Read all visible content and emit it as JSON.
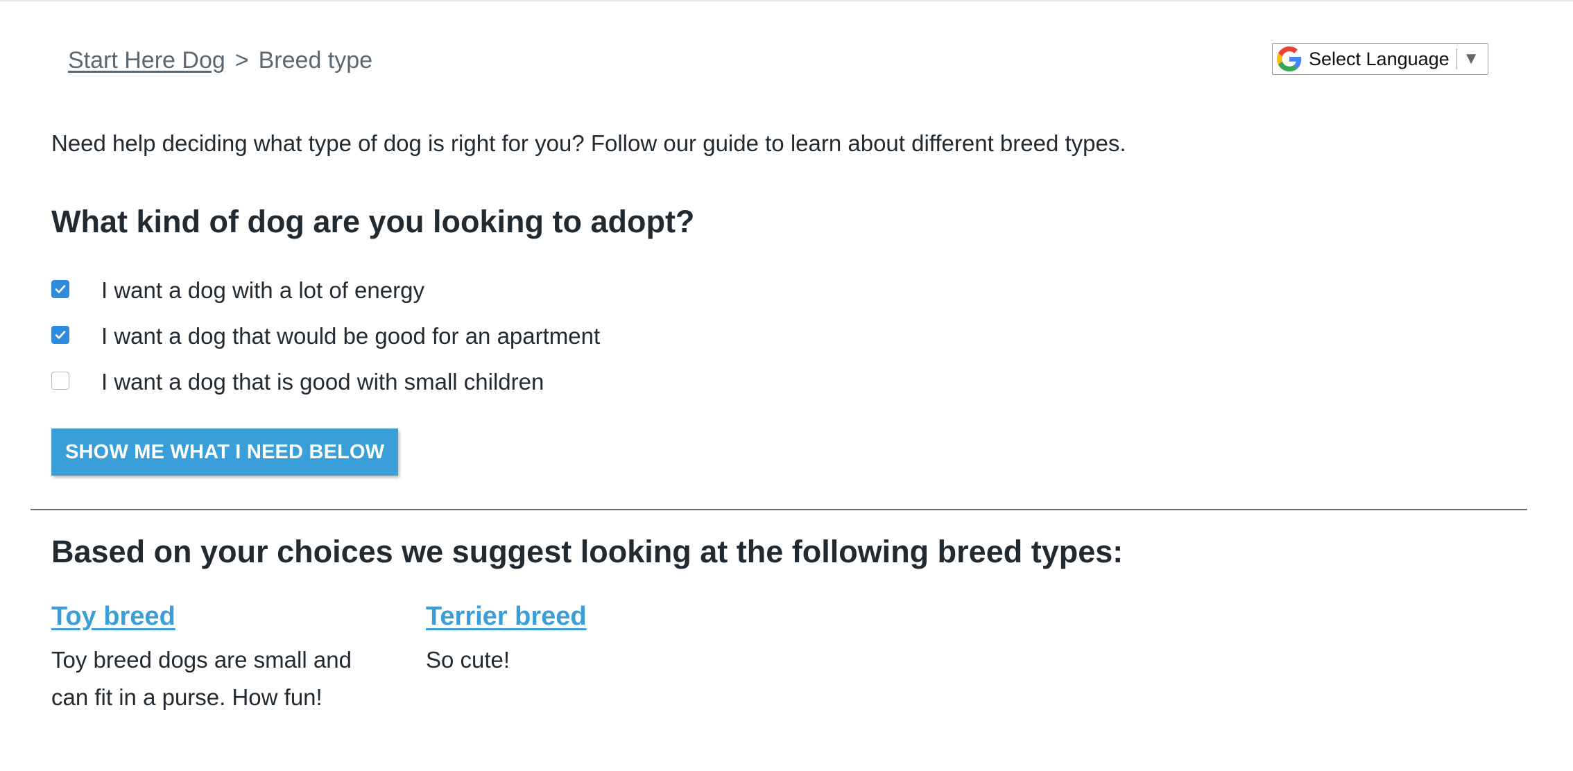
{
  "breadcrumb": {
    "home_label": "Start Here Dog",
    "separator": ">",
    "current": "Breed type"
  },
  "language": {
    "label": "Select Language",
    "arrow": "▼"
  },
  "intro_text": "Need help deciding what type of dog is right for you? Follow our guide to learn about different breed types.",
  "question": "What kind of dog are you looking to adopt?",
  "options": [
    {
      "label": "I want a dog with a lot of energy",
      "checked": true
    },
    {
      "label": "I want a dog that would be good for an apartment",
      "checked": true
    },
    {
      "label": "I want a dog that is good with small children",
      "checked": false
    }
  ],
  "cta_button": "SHOW ME WHAT I NEED BELOW",
  "results": {
    "heading": "Based on your choices we suggest looking at the following breed types:",
    "breeds": [
      {
        "name": "Toy breed",
        "description": "Toy breed dogs are small and can fit in a purse. How fun!"
      },
      {
        "name": "Terrier breed",
        "description": "So cute!"
      }
    ]
  },
  "colors": {
    "accent": "#3a9fd8",
    "checkbox_checked": "#2f8bdc",
    "text": "#222a31",
    "muted": "#5a6670"
  },
  "icons": {
    "language_logo": "google-g-icon",
    "checkbox_check": "checkmark-icon"
  }
}
